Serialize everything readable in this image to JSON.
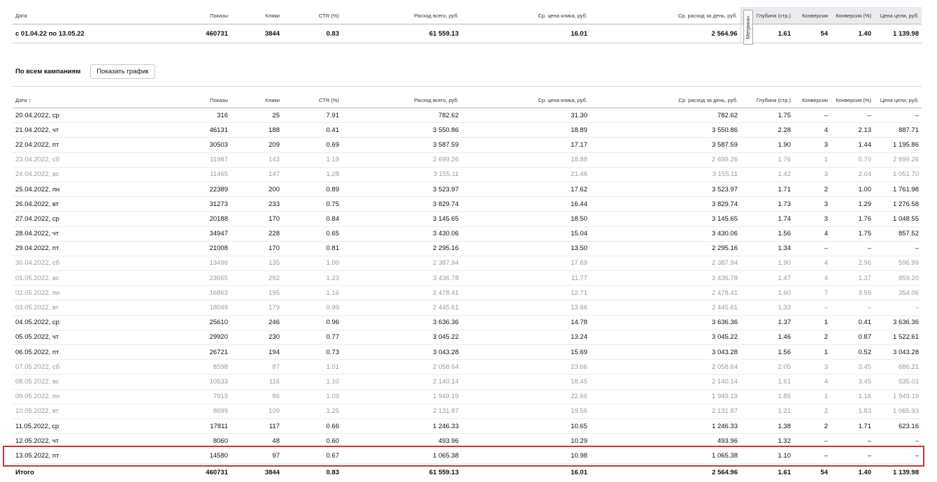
{
  "columns": [
    "Дата",
    "Показы",
    "Клики",
    "CTR (%)",
    "Расход всего, руб.",
    "Ср. цена клика, руб.",
    "Ср. расход за день, руб.",
    "Глубина (стр.)",
    "Конверсии",
    "Конверсия (%)",
    "Цена цели, руб."
  ],
  "metrika_label": "Метрика",
  "metrika_toggle": "«",
  "summary": {
    "row": [
      "с 01.04.22 по 13.05.22",
      "460731",
      "3844",
      "0.83",
      "61 559.13",
      "16.01",
      "2 564.96",
      "1.61",
      "54",
      "1.40",
      "1 139.98"
    ]
  },
  "controls": {
    "label": "По всем кампаниям",
    "button": "Показать график"
  },
  "detail": {
    "sort_arrow": "↑",
    "rows": [
      {
        "weekend": false,
        "cells": [
          "20.04.2022, ср",
          "316",
          "25",
          "7.91",
          "782.62",
          "31.30",
          "782.62",
          "1.75",
          "–",
          "–",
          "–"
        ]
      },
      {
        "weekend": false,
        "cells": [
          "21.04.2022, чт",
          "46131",
          "188",
          "0.41",
          "3 550.86",
          "18.89",
          "3 550.86",
          "2.28",
          "4",
          "2.13",
          "887.71"
        ]
      },
      {
        "weekend": false,
        "cells": [
          "22.04.2022, пт",
          "30503",
          "209",
          "0.69",
          "3 587.59",
          "17.17",
          "3 587.59",
          "1.90",
          "3",
          "1.44",
          "1 195.86"
        ]
      },
      {
        "weekend": true,
        "cells": [
          "23.04.2022, сб",
          "11987",
          "143",
          "1.19",
          "2 699.26",
          "18.88",
          "2 699.26",
          "1.76",
          "1",
          "0.70",
          "2 699.26"
        ]
      },
      {
        "weekend": true,
        "cells": [
          "24.04.2022, вс",
          "11465",
          "147",
          "1.28",
          "3 155.11",
          "21.46",
          "3 155.11",
          "1.42",
          "3",
          "2.04",
          "1 051.70"
        ]
      },
      {
        "weekend": false,
        "cells": [
          "25.04.2022, пн",
          "22389",
          "200",
          "0.89",
          "3 523.97",
          "17.62",
          "3 523.97",
          "1.71",
          "2",
          "1.00",
          "1 761.98"
        ]
      },
      {
        "weekend": false,
        "cells": [
          "26.04.2022, вт",
          "31273",
          "233",
          "0.75",
          "3 829.74",
          "16.44",
          "3 829.74",
          "1.73",
          "3",
          "1.29",
          "1 276.58"
        ]
      },
      {
        "weekend": false,
        "cells": [
          "27.04.2022, ср",
          "20188",
          "170",
          "0.84",
          "3 145.65",
          "18.50",
          "3 145.65",
          "1.74",
          "3",
          "1.76",
          "1 048.55"
        ]
      },
      {
        "weekend": false,
        "cells": [
          "28.04.2022, чт",
          "34947",
          "228",
          "0.65",
          "3 430.06",
          "15.04",
          "3 430.06",
          "1.56",
          "4",
          "1.75",
          "857.52"
        ]
      },
      {
        "weekend": false,
        "cells": [
          "29.04.2022, пт",
          "21008",
          "170",
          "0.81",
          "2 295.16",
          "13.50",
          "2 295.16",
          "1.34",
          "–",
          "–",
          "–"
        ]
      },
      {
        "weekend": true,
        "cells": [
          "30.04.2022, сб",
          "13496",
          "135",
          "1.00",
          "2 387.94",
          "17.69",
          "2 387.94",
          "1.90",
          "4",
          "2.96",
          "596.99"
        ]
      },
      {
        "weekend": true,
        "cells": [
          "01.05.2022, вс",
          "23665",
          "292",
          "1.23",
          "3 436.78",
          "11.77",
          "3 436.78",
          "1.47",
          "4",
          "1.37",
          "859.20"
        ]
      },
      {
        "weekend": true,
        "cells": [
          "02.05.2022, пн",
          "16863",
          "195",
          "1.16",
          "2 478.41",
          "12.71",
          "2 478.41",
          "1.60",
          "7",
          "3.59",
          "354.06"
        ]
      },
      {
        "weekend": true,
        "cells": [
          "03.05.2022, вт",
          "18049",
          "179",
          "0.99",
          "2 445.61",
          "13.66",
          "2 445.61",
          "1.33",
          "–",
          "–",
          "–"
        ]
      },
      {
        "weekend": false,
        "cells": [
          "04.05.2022, ср",
          "25610",
          "246",
          "0.96",
          "3 636.36",
          "14.78",
          "3 636.36",
          "1.37",
          "1",
          "0.41",
          "3 636.36"
        ]
      },
      {
        "weekend": false,
        "cells": [
          "05.05.2022, чт",
          "29920",
          "230",
          "0.77",
          "3 045.22",
          "13.24",
          "3 045.22",
          "1.46",
          "2",
          "0.87",
          "1 522.61"
        ]
      },
      {
        "weekend": false,
        "cells": [
          "06.05.2022, пт",
          "26721",
          "194",
          "0.73",
          "3 043.28",
          "15.69",
          "3 043.28",
          "1.56",
          "1",
          "0.52",
          "3 043.28"
        ]
      },
      {
        "weekend": true,
        "cells": [
          "07.05.2022, сб",
          "8598",
          "87",
          "1.01",
          "2 058.64",
          "23.66",
          "2 058.64",
          "2.05",
          "3",
          "3.45",
          "686.21"
        ]
      },
      {
        "weekend": true,
        "cells": [
          "08.05.2022, вс",
          "10533",
          "116",
          "1.10",
          "2 140.14",
          "18.45",
          "2 140.14",
          "1.61",
          "4",
          "3.45",
          "535.03"
        ]
      },
      {
        "weekend": true,
        "cells": [
          "09.05.2022, пн",
          "7919",
          "86",
          "1.09",
          "1 949.19",
          "22.66",
          "1 949.19",
          "1.85",
          "1",
          "1.16",
          "1 949.19"
        ]
      },
      {
        "weekend": true,
        "cells": [
          "10.05.2022, вт",
          "8699",
          "109",
          "1.25",
          "2 131.87",
          "19.56",
          "2 131.87",
          "1.21",
          "2",
          "1.83",
          "1 065.93"
        ]
      },
      {
        "weekend": false,
        "cells": [
          "11.05.2022, ср",
          "17811",
          "117",
          "0.66",
          "1 246.33",
          "10.65",
          "1 246.33",
          "1.38",
          "2",
          "1.71",
          "623.16"
        ]
      },
      {
        "weekend": false,
        "cells": [
          "12.05.2022, чт",
          "8060",
          "48",
          "0.60",
          "493.96",
          "10.29",
          "493.96",
          "1.32",
          "–",
          "–",
          "–"
        ]
      },
      {
        "weekend": false,
        "cells": [
          "13.05.2022, пт",
          "14580",
          "97",
          "0.67",
          "1 065.38",
          "10.98",
          "1 065.38",
          "1.10",
          "–",
          "–",
          "–"
        ]
      }
    ],
    "total": [
      "Итого",
      "460731",
      "3844",
      "0.83",
      "61 559.13",
      "16.01",
      "2 564.96",
      "1.61",
      "54",
      "1.40",
      "1 139.98"
    ]
  }
}
